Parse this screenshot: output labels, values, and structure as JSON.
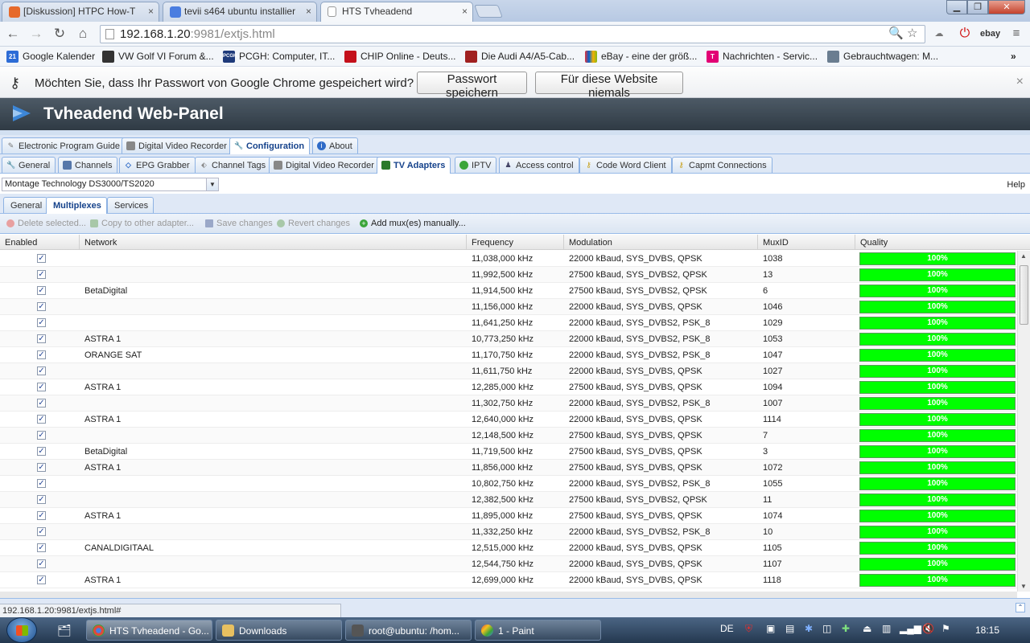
{
  "browser": {
    "tabs": [
      {
        "title": "[Diskussion] HTPC How-T",
        "active": false,
        "color": "#e66a2c"
      },
      {
        "title": "tevii s464 ubuntu installier",
        "active": false,
        "color": "#4a7de0"
      },
      {
        "title": "HTS Tvheadend",
        "active": true,
        "color": ""
      }
    ],
    "close_glyph": "×",
    "url_host": "192.168.1.20",
    "url_rest": ":9981/extjs.html",
    "extensions": [
      "ebay"
    ],
    "bookmarks": [
      {
        "label": "Google Kalender",
        "icon": "21",
        "color": "#2d6cd6"
      },
      {
        "label": "VW Golf VI Forum &...",
        "icon": "",
        "color": "#333333"
      },
      {
        "label": "PCGH: Computer, IT...",
        "icon": "PCGH",
        "color": "#1e3a7a"
      },
      {
        "label": "CHIP Online - Deuts...",
        "icon": "",
        "color": "#c4101b"
      },
      {
        "label": "Die Audi A4/A5-Cab...",
        "icon": "",
        "color": "#a02020"
      },
      {
        "label": "eBay - eine der größ...",
        "icon": "",
        "color": "#f4b400"
      },
      {
        "label": "Nachrichten - Servic...",
        "icon": "T",
        "color": "#e20074"
      },
      {
        "label": "Gebrauchtwagen: M...",
        "icon": "",
        "color": "#6a7d90"
      }
    ],
    "password_bar": {
      "message": "Möchten Sie, dass Ihr Passwort von Google Chrome gespeichert wird?",
      "save_button": "Passwort speichern",
      "never_button": "Für diese Website niemals"
    },
    "status_url": "192.168.1.20:9981/extjs.html#"
  },
  "app": {
    "title": "Tvheadend Web-Panel",
    "main_tabs": [
      "Electronic Program Guide",
      "Digital Video Recorder",
      "Configuration",
      "About"
    ],
    "config_tabs": [
      "General",
      "Channels",
      "EPG Grabber",
      "Channel Tags",
      "Digital Video Recorder",
      "TV Adapters",
      "IPTV",
      "Access control",
      "Code Word Client",
      "Capmt Connections"
    ],
    "adapter": "Montage Technology DS3000/TS2020",
    "help": "Help",
    "adapter_tabs": [
      "General",
      "Multiplexes",
      "Services"
    ],
    "actions": [
      "Delete selected...",
      "Copy to other adapter...",
      "Save changes",
      "Revert changes",
      "Add mux(es) manually..."
    ],
    "columns": [
      "Enabled",
      "Network",
      "Frequency",
      "Modulation",
      "MuxID",
      "Quality"
    ],
    "check_glyph": "✓",
    "rows": [
      {
        "network": "",
        "frequency": "11,038,000 kHz",
        "modulation": "22000 kBaud, SYS_DVBS, QPSK",
        "muxid": "1038",
        "quality": "100%"
      },
      {
        "network": "",
        "frequency": "11,992,500 kHz",
        "modulation": "27500 kBaud, SYS_DVBS2, QPSK",
        "muxid": "13",
        "quality": "100%"
      },
      {
        "network": "BetaDigital",
        "frequency": "11,914,500 kHz",
        "modulation": "27500 kBaud, SYS_DVBS2, QPSK",
        "muxid": "6",
        "quality": "100%"
      },
      {
        "network": "",
        "frequency": "11,156,000 kHz",
        "modulation": "22000 kBaud, SYS_DVBS, QPSK",
        "muxid": "1046",
        "quality": "100%"
      },
      {
        "network": "",
        "frequency": "11,641,250 kHz",
        "modulation": "22000 kBaud, SYS_DVBS2, PSK_8",
        "muxid": "1029",
        "quality": "100%"
      },
      {
        "network": "ASTRA 1",
        "frequency": "10,773,250 kHz",
        "modulation": "22000 kBaud, SYS_DVBS2, PSK_8",
        "muxid": "1053",
        "quality": "100%"
      },
      {
        "network": "ORANGE SAT",
        "frequency": "11,170,750 kHz",
        "modulation": "22000 kBaud, SYS_DVBS2, PSK_8",
        "muxid": "1047",
        "quality": "100%"
      },
      {
        "network": "",
        "frequency": "11,611,750 kHz",
        "modulation": "22000 kBaud, SYS_DVBS, QPSK",
        "muxid": "1027",
        "quality": "100%"
      },
      {
        "network": "ASTRA 1",
        "frequency": "12,285,000 kHz",
        "modulation": "27500 kBaud, SYS_DVBS, QPSK",
        "muxid": "1094",
        "quality": "100%"
      },
      {
        "network": "",
        "frequency": "11,302,750 kHz",
        "modulation": "22000 kBaud, SYS_DVBS2, PSK_8",
        "muxid": "1007",
        "quality": "100%"
      },
      {
        "network": "ASTRA 1",
        "frequency": "12,640,000 kHz",
        "modulation": "22000 kBaud, SYS_DVBS, QPSK",
        "muxid": "1114",
        "quality": "100%"
      },
      {
        "network": "",
        "frequency": "12,148,500 kHz",
        "modulation": "27500 kBaud, SYS_DVBS, QPSK",
        "muxid": "7",
        "quality": "100%"
      },
      {
        "network": "BetaDigital",
        "frequency": "11,719,500 kHz",
        "modulation": "27500 kBaud, SYS_DVBS, QPSK",
        "muxid": "3",
        "quality": "100%"
      },
      {
        "network": "ASTRA 1",
        "frequency": "11,856,000 kHz",
        "modulation": "27500 kBaud, SYS_DVBS, QPSK",
        "muxid": "1072",
        "quality": "100%"
      },
      {
        "network": "",
        "frequency": "10,802,750 kHz",
        "modulation": "22000 kBaud, SYS_DVBS2, PSK_8",
        "muxid": "1055",
        "quality": "100%"
      },
      {
        "network": "",
        "frequency": "12,382,500 kHz",
        "modulation": "27500 kBaud, SYS_DVBS2, QPSK",
        "muxid": "11",
        "quality": "100%"
      },
      {
        "network": "ASTRA 1",
        "frequency": "11,895,000 kHz",
        "modulation": "27500 kBaud, SYS_DVBS, QPSK",
        "muxid": "1074",
        "quality": "100%"
      },
      {
        "network": "",
        "frequency": "11,332,250 kHz",
        "modulation": "22000 kBaud, SYS_DVBS2, PSK_8",
        "muxid": "10",
        "quality": "100%"
      },
      {
        "network": "CANALDIGITAAL",
        "frequency": "12,515,000 kHz",
        "modulation": "22000 kBaud, SYS_DVBS, QPSK",
        "muxid": "1105",
        "quality": "100%"
      },
      {
        "network": "",
        "frequency": "12,544,750 kHz",
        "modulation": "22000 kBaud, SYS_DVBS, QPSK",
        "muxid": "1107",
        "quality": "100%"
      },
      {
        "network": "ASTRA 1",
        "frequency": "12,699,000 kHz",
        "modulation": "22000 kBaud, SYS_DVBS, QPSK",
        "muxid": "1118",
        "quality": "100%"
      }
    ],
    "quality_color": "#00ff00"
  },
  "taskbar": {
    "items": [
      "HTS Tvheadend - Go...",
      "Downloads",
      "root@ubuntu: /hom...",
      "1 - Paint"
    ],
    "language": "DE",
    "clock": "18:15"
  }
}
